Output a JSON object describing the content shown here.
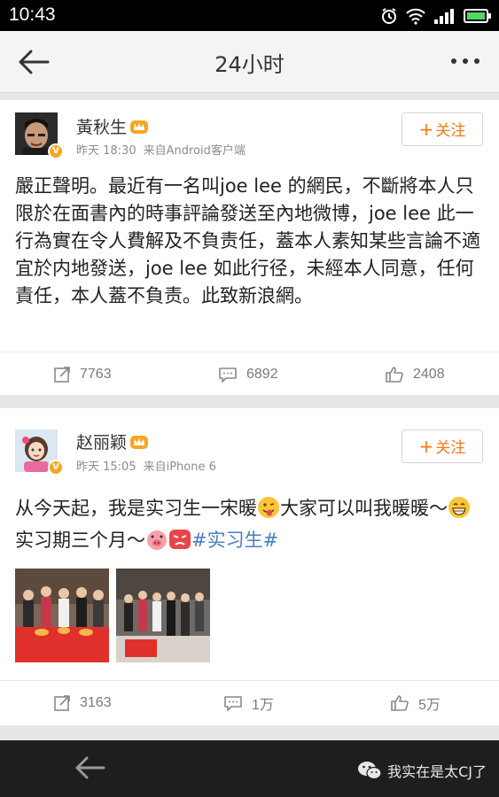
{
  "status_bar": {
    "time": "10:43"
  },
  "nav": {
    "title": "24小时"
  },
  "posts": [
    {
      "author": "黃秋生",
      "time": "昨天 18:30",
      "source": "来自Android客户端",
      "follow_label": "关注",
      "text": "嚴正聲明。最近有一名叫joe lee 的網民，不斷將本人只限於在面書內的時事評論發送至內地微博，joe lee 此一行為實在令人費解及不負责任，蓋本人素知某些言論不適宜於内地發送，joe lee 如此行径，未經本人同意，任何責任，本人蓋不負责。此致新浪網。",
      "reposts": "7763",
      "comments": "6892",
      "likes": "2408"
    },
    {
      "author": "赵丽颖",
      "time": "昨天 15:05",
      "source": "来自iPhone 6",
      "follow_label": "关注",
      "text_part1": "从今天起，我是实习生一宋暖",
      "text_part2": "大家可以叫我暖暖～",
      "text_part3": "实习期三个月～",
      "hashtag": "#实习生#",
      "reposts": "3163",
      "comments": "1万",
      "likes": "5万"
    }
  ],
  "bottom_bar": {
    "watermark": "我实在是太CJ了"
  },
  "icons": {
    "back": "back-arrow-icon",
    "more": "more-icon",
    "repost": "repost-icon",
    "comment": "comment-icon",
    "like": "like-icon"
  },
  "colors": {
    "follow": "#f17b19",
    "hashtag": "#4a7ec2",
    "verified": "#f5a623"
  }
}
